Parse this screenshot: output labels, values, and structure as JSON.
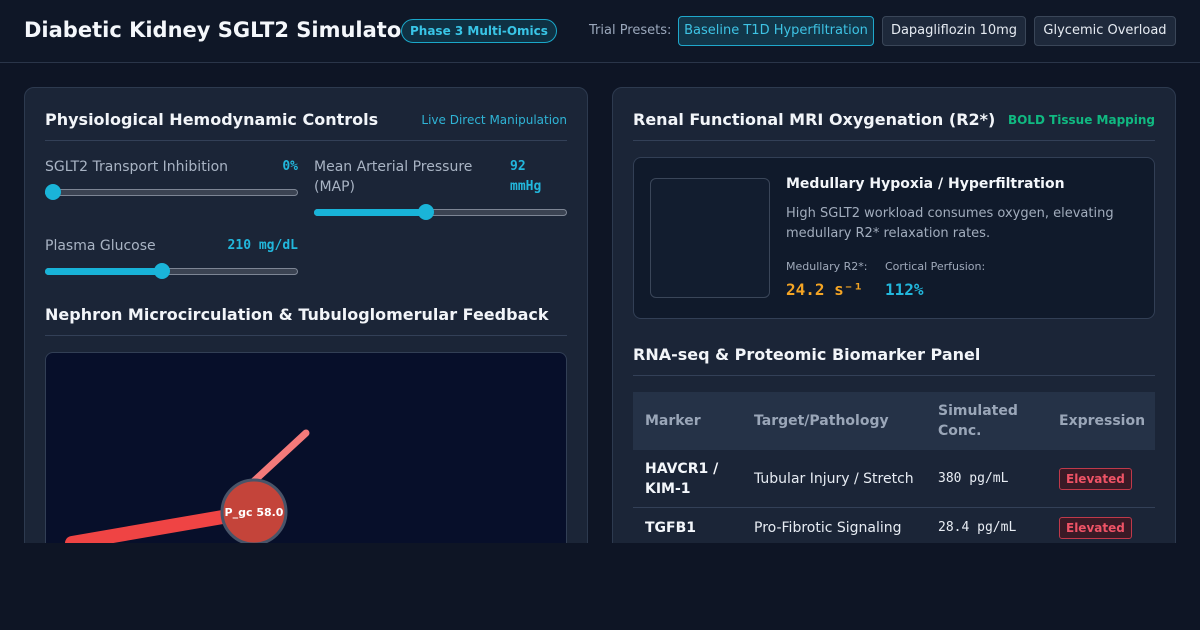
{
  "header": {
    "title": "Diabetic Kidney SGLT2 Simulator",
    "phase_badge": "Phase 3 Multi-Omics",
    "presets_label": "Trial Presets:",
    "presets": [
      {
        "label": "Baseline T1D Hyperfiltration",
        "active": true
      },
      {
        "label": "Dapagliflozin 10mg",
        "active": false
      },
      {
        "label": "Glycemic Overload",
        "active": false
      }
    ]
  },
  "controls": {
    "title": "Physiological Hemodynamic Controls",
    "tag": "Live Direct Manipulation",
    "sglt2": {
      "label": "SGLT2 Transport Inhibition",
      "value": "0%",
      "level": 0.0
    },
    "map": {
      "label": "Mean Arterial Pressure (MAP)",
      "value": "92 mmHg",
      "level": 0.44
    },
    "glucose": {
      "label": "Plasma Glucose",
      "value": "210 mg/dL",
      "level": 0.46
    }
  },
  "nephron": {
    "title": "Nephron Microcirculation & Tubuloglomerular Feedback",
    "glomerulus_label": "P_gc 58.0"
  },
  "mri": {
    "title": "Renal Functional MRI Oxygenation (R2*)",
    "tag": "BOLD Tissue Mapping",
    "card_title": "Medullary Hypoxia / Hyperfiltration",
    "card_desc": "High SGLT2 workload consumes oxygen, elevating medullary R2* relaxation rates.",
    "r2_label": "Medullary R2*:",
    "r2_value": "24.2 s⁻¹",
    "perfusion_label": "Cortical Perfusion:",
    "perfusion_value": "112%"
  },
  "biomarkers": {
    "title": "RNA-seq & Proteomic Biomarker Panel",
    "columns": [
      "Marker",
      "Target/Pathology",
      "Simulated Conc.",
      "Expression"
    ],
    "rows": [
      {
        "marker": "HAVCR1 / KIM-1",
        "target": "Tubular Injury / Stretch",
        "conc": "380 pg/mL",
        "expression": "Elevated"
      },
      {
        "marker": "TGFB1",
        "target": "Pro-Fibrotic Signaling",
        "conc": "28.4 pg/mL",
        "expression": "Elevated"
      }
    ]
  },
  "colors": {
    "accent": "#1ab4d8",
    "success_tag": "#10b981",
    "warning_value": "#f5a524",
    "danger": "#ef5366",
    "arteriole": "#ef4444",
    "glomerulus": "#c4443a"
  }
}
